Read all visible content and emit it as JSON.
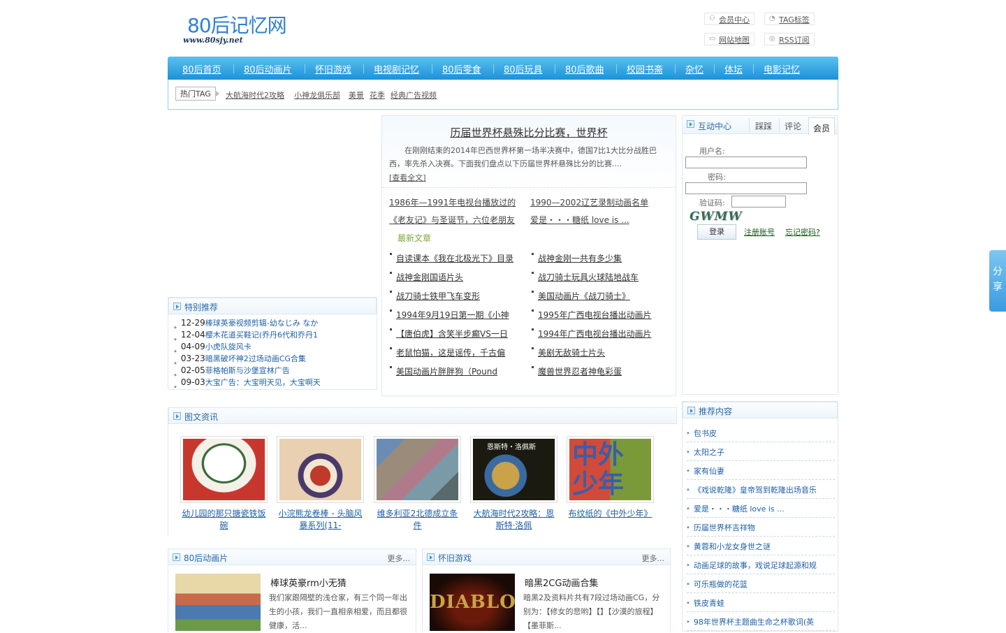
{
  "header": {
    "logo_text": "80后记忆网",
    "logo_url": "www.80sjy.net",
    "toplinks": [
      {
        "label": "会员中心",
        "icon": "user-icon"
      },
      {
        "label": "TAG标签",
        "icon": "tag-icon"
      },
      {
        "label": "网站地图",
        "icon": "map-icon"
      },
      {
        "label": "RSS订阅",
        "icon": "rss-icon"
      }
    ]
  },
  "nav": [
    "80后首页",
    "80后动画片",
    "怀旧游戏",
    "电视剧记忆",
    "80后零食",
    "80后玩具",
    "80后歌曲",
    "校园书斋",
    "杂忆",
    "体坛",
    "电影记忆"
  ],
  "tagbar": {
    "label": "热门TAG",
    "tags": [
      "大航海时代2攻略",
      "小神龙俱乐部",
      "美景",
      "花季",
      "经典广告视频"
    ]
  },
  "special": {
    "title": "特别推荐",
    "items": [
      {
        "date": "12-29",
        "title": "棒球英豪视频剪辑-幼なじみ なか"
      },
      {
        "date": "12-04",
        "title": "樱木花道买鞋记(乔丹6代和乔丹1"
      },
      {
        "date": "04-09",
        "title": "小虎队旋风卡"
      },
      {
        "date": "03-23",
        "title": "暗黑破坏神2过场动画CG合集"
      },
      {
        "date": "02-05",
        "title": "菲格帕斯与沙堡宣林广告"
      },
      {
        "date": "09-03",
        "title": "大宝广告：大宝明天见，大宝啊天"
      }
    ]
  },
  "headline": {
    "title": "历届世界杯悬殊比分比赛，世界杯",
    "summary": "在刚刚结束的2014年巴西世界杯第一场半决赛中，德国7比1大比分战胜巴西，率先杀入决赛。下面我们盘点以下历届世界杯悬殊比分的比赛....",
    "more": "[查看全文]",
    "pairs": [
      "1986年—1991年电视台播放过的",
      "1990—2002辽艺录制动画名单",
      "《老友记》与圣诞节，六位老朋友",
      "爱是・・・糖纸 love is ..."
    ]
  },
  "latest": {
    "title": "最新文章",
    "left": [
      "自读课本《我在北极光下》目录",
      "战神金刚国语片头",
      "战刀骑士铁甲飞车变形",
      "1994年9月19日第一期《小神",
      "【唐伯虎】含笑半步癫VS一日",
      "老鼠怕猫，这是谣传，千古偏",
      "美国动画片胖胖狗（Pound"
    ],
    "right": [
      "战神金刚一共有多少集",
      "战刀骑士玩具火球陆地战车",
      "美国动画片《战刀骑士》",
      "1995年广西电视台播出动画片",
      "1994年广西电视台播出动画片",
      "美剧无敌骑士片头",
      "魔兽世界忍者神龟彩蛋"
    ]
  },
  "interact": {
    "title": "互动中心",
    "tabs": [
      "踩踩",
      "评论",
      "会员"
    ],
    "username_label": "用户名:",
    "password_label": "密码:",
    "captcha_label": "验证码:",
    "captcha_text": "GWMW",
    "login": "登录",
    "register": "注册账号",
    "forgot": "忘记密码?"
  },
  "photo": {
    "title": "图文资讯",
    "items": [
      {
        "caption": "幼儿园的那只搪瓷铁饭碗",
        "bg": "#c8372e"
      },
      {
        "caption": "小浣熊龙卷棒 - 头脑风暴系列(11-",
        "bg": "#e8d0b0"
      },
      {
        "caption": "维多利亚2北德成立条件",
        "bg": "#8a7d7a"
      },
      {
        "caption": "大航海时代2攻略：恩斯特·洛佩",
        "bg": "#1a1a10",
        "overlay": "恩斯特・洛佩斯"
      },
      {
        "caption": "布纹纸的《中外少年》",
        "bg": "#7a9a3a",
        "overlay": "中外少年"
      }
    ]
  },
  "col1": {
    "title": "80后动画片",
    "more": "更多...",
    "headline": "棒球英豪rm小无猜",
    "text": "我们家跟隔壁的浅仓家，有三个同一年出生的小孩，我们一直相亲相爱，而且都很健康，活..."
  },
  "col2": {
    "title": "怀旧游戏",
    "more": "更多...",
    "headline": "暗黑2CG动画合集",
    "text": "暗黑2及资料片共有7段过场动画CG，分别为：【修女的悲哟】【】【沙漠的旅程】【墨菲斯...",
    "logo": "DIABLO"
  },
  "recommend": {
    "title": "推荐内容",
    "items": [
      "包书皮",
      "太阳之子",
      "家有仙妻",
      "《戏说乾隆》皇帝驾到乾隆出场音乐",
      "爱是・・・糖纸 love is ...",
      "历届世界杯吉祥物",
      "黄蓉和小龙女身世之谜",
      "动画足球的故事，戏说足球起源和规",
      "可乐瓶做的花篮",
      "铁皮青蛙",
      "98年世界杯主题曲生命之杯歌词(英"
    ]
  },
  "share": "分享"
}
